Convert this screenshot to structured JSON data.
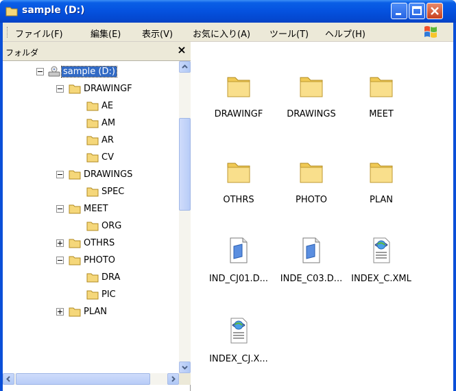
{
  "window": {
    "title": "sample (D:)"
  },
  "menu": {
    "items": [
      "ファイル(F)",
      "編集(E)",
      "表示(V)",
      "お気に入り(A)",
      "ツール(T)",
      "ヘルプ(H)"
    ]
  },
  "folder_pane": {
    "title": "フォルダ",
    "close_label": "×",
    "tree": [
      {
        "label": "sample (D:)",
        "type": "drive",
        "expander": "minus",
        "selected": true
      },
      {
        "label": "DRAWINGF",
        "type": "folder",
        "expander": "minus"
      },
      {
        "label": "AE",
        "type": "folder",
        "expander": "none"
      },
      {
        "label": "AM",
        "type": "folder",
        "expander": "none"
      },
      {
        "label": "AR",
        "type": "folder",
        "expander": "none"
      },
      {
        "label": "CV",
        "type": "folder",
        "expander": "none"
      },
      {
        "label": "DRAWINGS",
        "type": "folder",
        "expander": "minus"
      },
      {
        "label": "SPEC",
        "type": "folder",
        "expander": "none"
      },
      {
        "label": "MEET",
        "type": "folder",
        "expander": "minus"
      },
      {
        "label": "ORG",
        "type": "folder",
        "expander": "none"
      },
      {
        "label": "OTHRS",
        "type": "folder",
        "expander": "plus"
      },
      {
        "label": "PHOTO",
        "type": "folder",
        "expander": "minus"
      },
      {
        "label": "DRA",
        "type": "folder",
        "expander": "none"
      },
      {
        "label": "PIC",
        "type": "folder",
        "expander": "none"
      },
      {
        "label": "PLAN",
        "type": "folder",
        "expander": "plus"
      }
    ]
  },
  "files": [
    {
      "label": "DRAWINGF",
      "icon": "folder-icon"
    },
    {
      "label": "DRAWINGS",
      "icon": "folder-icon"
    },
    {
      "label": "MEET",
      "icon": "folder-icon"
    },
    {
      "label": "OTHRS",
      "icon": "folder-icon"
    },
    {
      "label": "PHOTO",
      "icon": "folder-icon"
    },
    {
      "label": "PLAN",
      "icon": "folder-icon"
    },
    {
      "label": "IND_CJ01.D...",
      "icon": "document-icon"
    },
    {
      "label": "INDE_C03.D...",
      "icon": "document-icon"
    },
    {
      "label": "INDEX_C.XML",
      "icon": "xml-file-icon"
    },
    {
      "label": "INDEX_CJ.X...",
      "icon": "xml-file-icon"
    }
  ],
  "colors": {
    "titlebar": "#0553e0",
    "selection": "#316ac5",
    "folder": "#f5d77a"
  }
}
